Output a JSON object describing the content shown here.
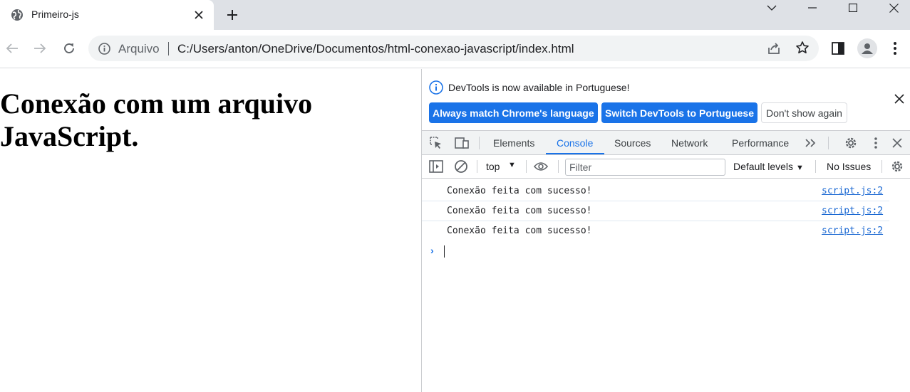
{
  "browser": {
    "tab_title": "Primeiro-js",
    "omnibox": {
      "scheme_label": "Arquivo",
      "url": "C:/Users/anton/OneDrive/Documentos/html-conexao-javascript/index.html"
    }
  },
  "page": {
    "heading": "Conexão com um arquivo JavaScript."
  },
  "devtools": {
    "infobar": {
      "message": "DevTools is now available in Portuguese!",
      "buttons": {
        "match_language": "Always match Chrome's language",
        "switch_language": "Switch DevTools to Portuguese",
        "dont_show": "Don't show again"
      }
    },
    "tabs": [
      {
        "label": "Elements"
      },
      {
        "label": "Console",
        "active": true
      },
      {
        "label": "Sources"
      },
      {
        "label": "Network"
      },
      {
        "label": "Performance"
      }
    ],
    "console_bar": {
      "context": "top",
      "filter_placeholder": "Filter",
      "levels": "Default levels",
      "issues": "No Issues"
    },
    "console_logs": [
      {
        "message": "Conexão feita com sucesso!",
        "source": "script.js:2"
      },
      {
        "message": "Conexão feita com sucesso!",
        "source": "script.js:2"
      },
      {
        "message": "Conexão feita com sucesso!",
        "source": "script.js:2"
      }
    ]
  },
  "icons": {
    "tab_favicon": "globe-icon",
    "tab_close": "close-icon",
    "new_tab": "plus-icon",
    "back": "arrow-left-icon",
    "forward": "arrow-right-icon",
    "reload": "reload-icon",
    "info": "info-icon",
    "share": "share-icon",
    "bookmark": "star-icon",
    "side_panel": "side-panel-icon",
    "profile": "profile-icon",
    "menu": "kebab-menu-icon"
  },
  "colors": {
    "accent": "#1a73e8",
    "tabstrip_bg": "#dee1e6",
    "omnibox_bg": "#f1f3f4"
  }
}
